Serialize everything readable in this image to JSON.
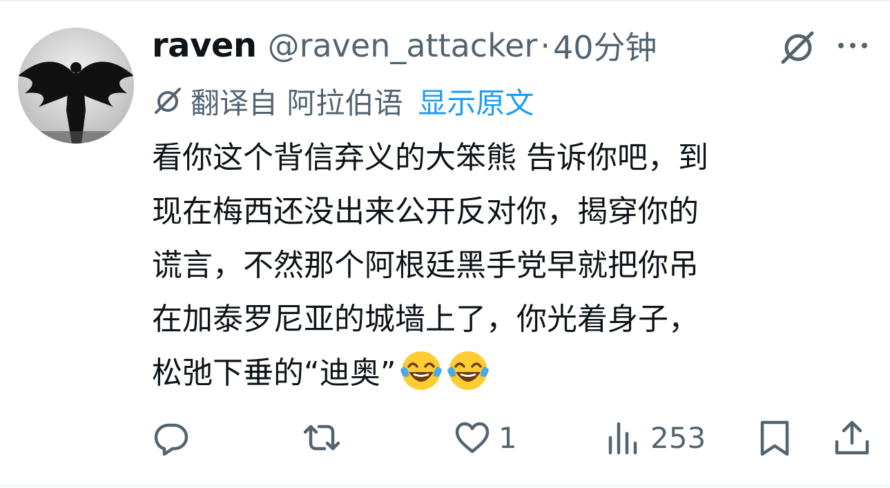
{
  "tweet": {
    "author": {
      "display_name": "raven",
      "handle": "@raven_attacker",
      "separator": "·",
      "time": "40分钟"
    },
    "translation": {
      "translated_from": "翻译自 阿拉伯语",
      "show_original": "显示原文"
    },
    "text_lines": [
      "看你这个背信弃义的大笨熊 告诉你吧，到",
      "现在梅西还没出来公开反对你，揭穿你的",
      "谎言，不然那个阿根廷黑手党早就把你吊",
      "在加泰罗尼亚的城墙上了，你光着身子，",
      "松弛下垂的“迪奥”"
    ],
    "emojis": [
      "face-with-tears-of-joy",
      "face-with-tears-of-joy"
    ],
    "actions": {
      "reply_count": "",
      "retweet_count": "",
      "like_count": "1",
      "views_count": "253"
    },
    "icons": {
      "grok": "grok-icon",
      "more": "more-icon",
      "translate": "grok-translate-icon",
      "reply": "reply-icon",
      "retweet": "retweet-icon",
      "like": "heart-icon",
      "views": "views-icon",
      "bookmark": "bookmark-icon",
      "share": "share-icon"
    },
    "colors": {
      "text": "#0f1419",
      "secondary": "#536471",
      "link": "#1d9bf0"
    }
  }
}
